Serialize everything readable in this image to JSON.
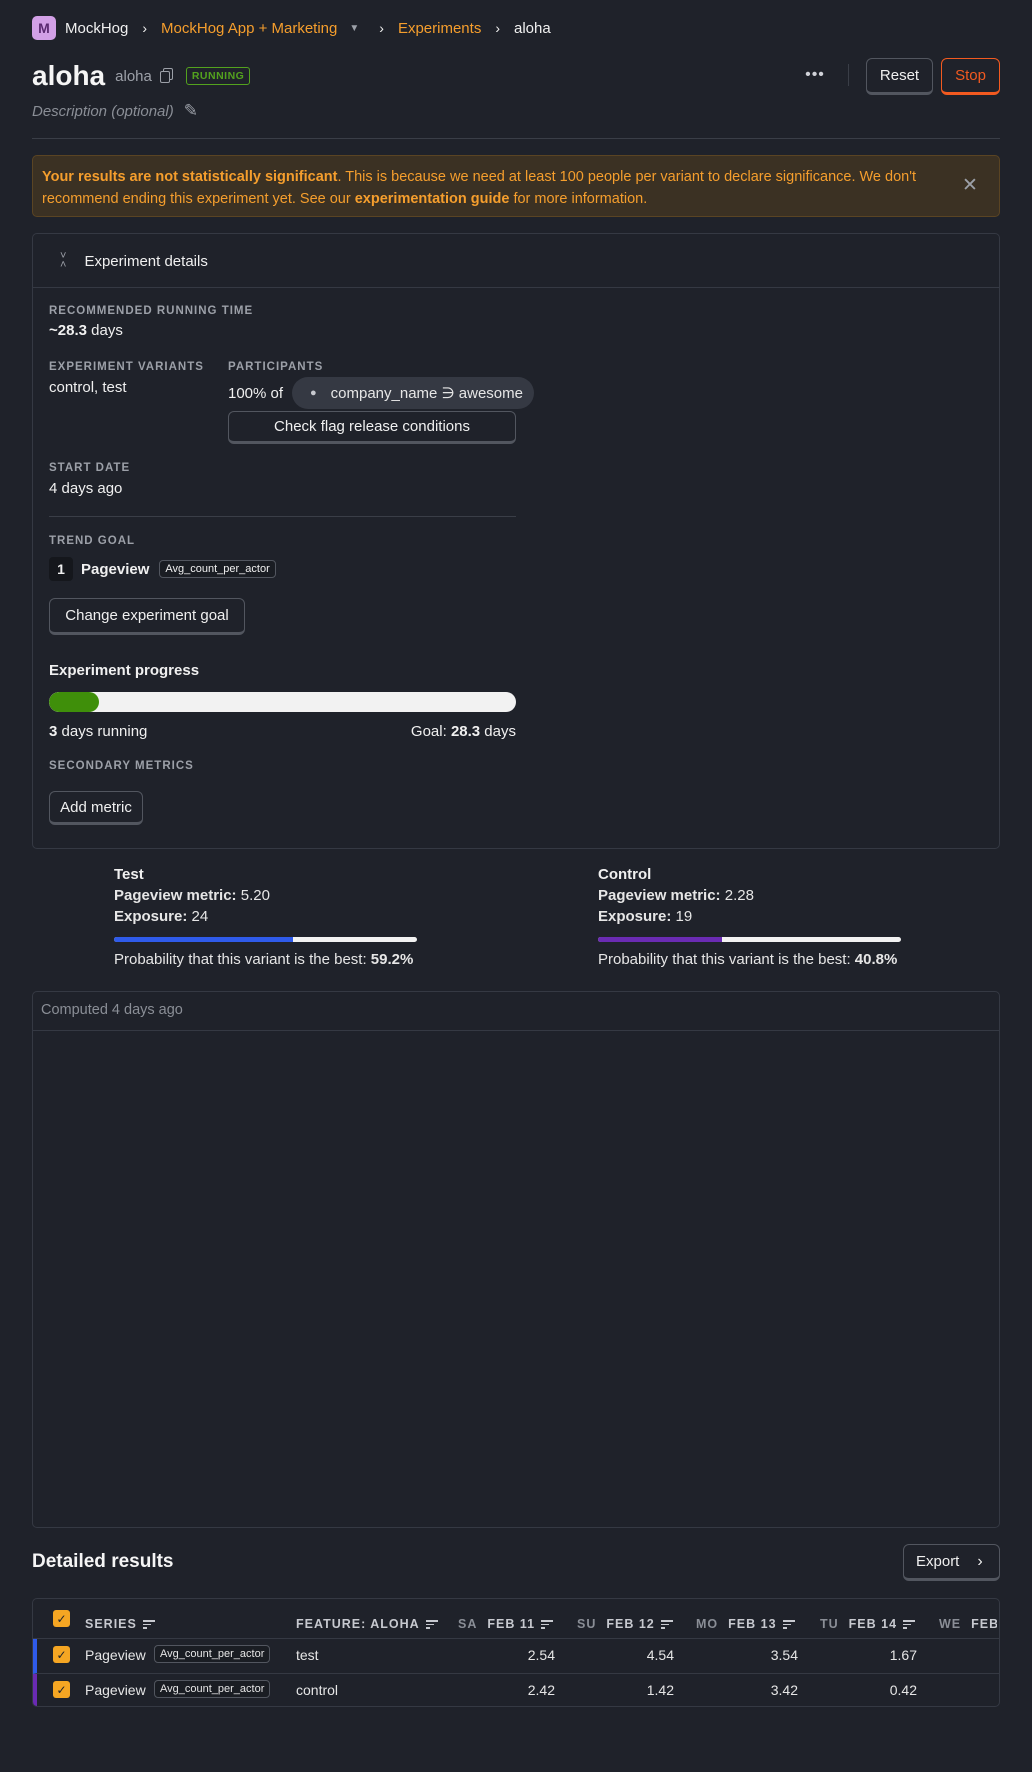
{
  "breadcrumb": {
    "org_initial": "M",
    "org": "MockHog",
    "project": "MockHog App + Marketing",
    "section": "Experiments",
    "current": "aloha"
  },
  "header": {
    "title": "aloha",
    "key": "aloha",
    "status": "RUNNING",
    "description_placeholder": "Description (optional)",
    "reset_label": "Reset",
    "stop_label": "Stop"
  },
  "banner": {
    "bold": "Your results are not statistically significant",
    "text1": ". This is because we need at least 100 people per variant to declare significance. We don't recommend ending this experiment yet. See our ",
    "link": "experimentation guide",
    "text2": " for more information."
  },
  "details": {
    "section_title": "Experiment details",
    "running_time_label": "RECOMMENDED RUNNING TIME",
    "running_time_prefix": "~",
    "running_time_value": "28.3",
    "running_time_unit": " days",
    "variants_label": "EXPERIMENT VARIANTS",
    "variants_value": "control, test",
    "participants_label": "PARTICIPANTS",
    "participants_percent": "100% of",
    "participants_filter": "company_name ∋ awesome",
    "check_flag_label": "Check flag release conditions",
    "start_date_label": "START DATE",
    "start_date_value": "4 days ago",
    "trend_goal_label": "TREND GOAL",
    "goal_index": "1",
    "goal_event": "Pageview",
    "goal_math": "Avg_count_per_actor",
    "change_goal_label": "Change experiment goal",
    "progress_title": "Experiment progress",
    "progress_fraction": 0.106,
    "days_running": "3",
    "days_running_suffix": " days running",
    "goal_prefix": "Goal: ",
    "goal_days": "28.3",
    "goal_suffix": " days",
    "secondary_label": "SECONDARY METRICS",
    "add_metric_label": "Add metric"
  },
  "variants": [
    {
      "name": "Test",
      "metric_label": "Pageview metric:",
      "metric_value": "5.20",
      "exposure_label": "Exposure:",
      "exposure_value": "24",
      "prob_label": "Probability that this variant is the best: ",
      "prob_value": "59.2%",
      "prob_fraction": 0.592,
      "color": "#2f5bea"
    },
    {
      "name": "Control",
      "metric_label": "Pageview metric:",
      "metric_value": "2.28",
      "exposure_label": "Exposure:",
      "exposure_value": "19",
      "prob_label": "Probability that this variant is the best: ",
      "prob_value": "40.8%",
      "prob_fraction": 0.408,
      "color": "#6a2bb3"
    }
  ],
  "chart_panel": {
    "computed": "Computed 4 days ago"
  },
  "results": {
    "title": "Detailed results",
    "export_label": "Export",
    "columns": [
      {
        "day": "",
        "label": "SERIES"
      },
      {
        "day": "",
        "label": "FEATURE: ALOHA"
      },
      {
        "day": "SA",
        "label": "FEB 11"
      },
      {
        "day": "SU",
        "label": "FEB 12"
      },
      {
        "day": "MO",
        "label": "FEB 13"
      },
      {
        "day": "TU",
        "label": "FEB 14"
      },
      {
        "day": "WE",
        "label": "FEB"
      }
    ],
    "rows": [
      {
        "series": "Pageview",
        "math": "Avg_count_per_actor",
        "variant": "test",
        "values": [
          "2.54",
          "4.54",
          "3.54",
          "1.67"
        ],
        "color": "#2f5bea"
      },
      {
        "series": "Pageview",
        "math": "Avg_count_per_actor",
        "variant": "control",
        "values": [
          "2.42",
          "1.42",
          "3.42",
          "0.42"
        ],
        "color": "#6a2bb3"
      }
    ]
  },
  "colors": {
    "accent": "#f59e2d",
    "stop": "#f25a20",
    "running": "#53a21e",
    "progress": "#3f8f0a"
  }
}
